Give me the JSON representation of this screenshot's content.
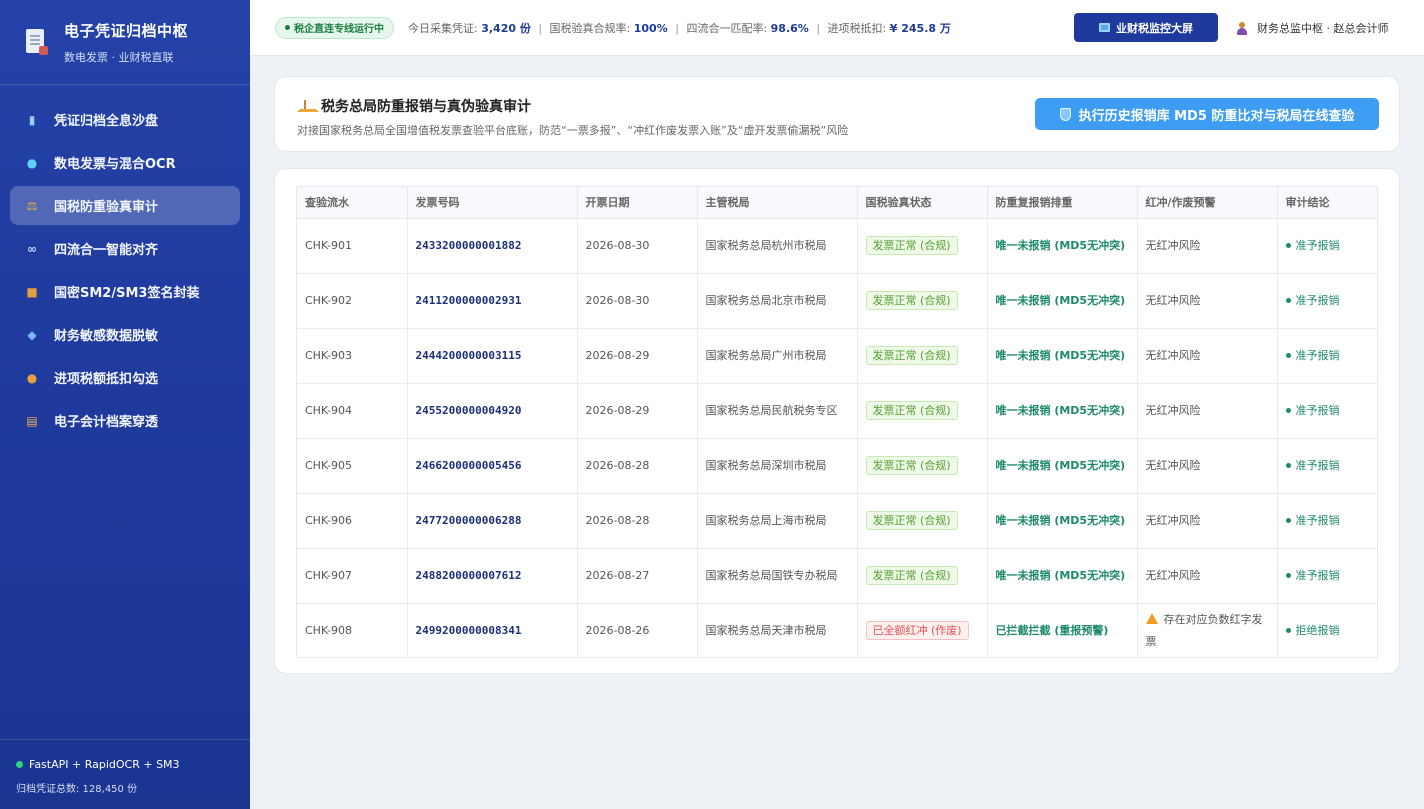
{
  "sidebar": {
    "brand_title": "电子凭证归档中枢",
    "brand_subtitle": "数电发票 · 业财税直联",
    "items": [
      {
        "label": "凭证归档全息沙盘",
        "icon": "bar-chart-icon"
      },
      {
        "label": "数电发票与混合OCR",
        "icon": "magnifier-icon"
      },
      {
        "label": "国税防重验真审计",
        "icon": "scale-icon"
      },
      {
        "label": "四流合一智能对齐",
        "icon": "link-icon"
      },
      {
        "label": "国密SM2/SM3签名封装",
        "icon": "lock-icon"
      },
      {
        "label": "财务敏感数据脱敏",
        "icon": "shield-icon"
      },
      {
        "label": "进项税额抵扣勾选",
        "icon": "money-bag-icon"
      },
      {
        "label": "电子会计档案穿透",
        "icon": "scroll-icon"
      }
    ],
    "active_index": 2,
    "footer_stack": "FastAPI + RapidOCR + SM3",
    "footer_total": "归档凭证总数: 128,450 份"
  },
  "topbar": {
    "status": "税企直连专线运行中",
    "metrics": {
      "collect_label": "今日采集凭证: ",
      "collect_value": "3,420 份",
      "verify_label": "国税验真合规率: ",
      "verify_value": "100%",
      "match_label": "四流合一匹配率: ",
      "match_value": "98.6%",
      "deduct_label": "进项税抵扣: ",
      "deduct_value": "¥ 245.8 万",
      "separator": "|"
    },
    "screen_button": "业财税监控大屏",
    "user": "财务总监中枢 · 赵总会计师"
  },
  "header": {
    "title": "税务总局防重报销与真伪验真审计",
    "description": "对接国家税务总局全国增值税发票查验平台底账，防范“一票多报”、“冲红作废发票入账”及“虚开发票偷漏税”风险",
    "action_button": "执行历史报销库 MD5 防重比对与税局在线查验"
  },
  "table": {
    "columns": [
      "查验流水",
      "发票号码",
      "开票日期",
      "主管税局",
      "国税验真状态",
      "防重复报销排重",
      "红冲/作废预警",
      "审计结论"
    ],
    "rows": [
      {
        "id": "CHK-901",
        "invoice": "2433200000001882",
        "date": "2026-08-30",
        "bureau": "国家税务总局杭州市税局",
        "status": "发票正常 (合规)",
        "status_type": "ok",
        "dup": "唯一未报销 (MD5无冲突)",
        "warn": "无红冲风险",
        "warn_alert": false,
        "conclusion": "准予报销"
      },
      {
        "id": "CHK-902",
        "invoice": "2411200000002931",
        "date": "2026-08-30",
        "bureau": "国家税务总局北京市税局",
        "status": "发票正常 (合规)",
        "status_type": "ok",
        "dup": "唯一未报销 (MD5无冲突)",
        "warn": "无红冲风险",
        "warn_alert": false,
        "conclusion": "准予报销"
      },
      {
        "id": "CHK-903",
        "invoice": "2444200000003115",
        "date": "2026-08-29",
        "bureau": "国家税务总局广州市税局",
        "status": "发票正常 (合规)",
        "status_type": "ok",
        "dup": "唯一未报销 (MD5无冲突)",
        "warn": "无红冲风险",
        "warn_alert": false,
        "conclusion": "准予报销"
      },
      {
        "id": "CHK-904",
        "invoice": "2455200000004920",
        "date": "2026-08-29",
        "bureau": "国家税务总局民航税务专区",
        "status": "发票正常 (合规)",
        "status_type": "ok",
        "dup": "唯一未报销 (MD5无冲突)",
        "warn": "无红冲风险",
        "warn_alert": false,
        "conclusion": "准予报销"
      },
      {
        "id": "CHK-905",
        "invoice": "2466200000005456",
        "date": "2026-08-28",
        "bureau": "国家税务总局深圳市税局",
        "status": "发票正常 (合规)",
        "status_type": "ok",
        "dup": "唯一未报销 (MD5无冲突)",
        "warn": "无红冲风险",
        "warn_alert": false,
        "conclusion": "准予报销"
      },
      {
        "id": "CHK-906",
        "invoice": "2477200000006288",
        "date": "2026-08-28",
        "bureau": "国家税务总局上海市税局",
        "status": "发票正常 (合规)",
        "status_type": "ok",
        "dup": "唯一未报销 (MD5无冲突)",
        "warn": "无红冲风险",
        "warn_alert": false,
        "conclusion": "准予报销"
      },
      {
        "id": "CHK-907",
        "invoice": "2488200000007612",
        "date": "2026-08-27",
        "bureau": "国家税务总局国铁专办税局",
        "status": "发票正常 (合规)",
        "status_type": "ok",
        "dup": "唯一未报销 (MD5无冲突)",
        "warn": "无红冲风险",
        "warn_alert": false,
        "conclusion": "准予报销"
      },
      {
        "id": "CHK-908",
        "invoice": "2499200000008341",
        "date": "2026-08-26",
        "bureau": "国家税务总局天津市税局",
        "status": "已全额红冲 (作废)",
        "status_type": "bad",
        "dup": "已拦截拦截 (重报预警)",
        "warn": "存在对应负数红字发票",
        "warn_alert": true,
        "conclusion": "拒绝报销"
      }
    ]
  },
  "colors": {
    "sidebar_bg": "#2442a8",
    "accent_blue": "#3d9df2",
    "primary_navy": "#1e3a9c",
    "ok_green": "#55a030",
    "danger_red": "#e05252",
    "teal": "#1e8a6a"
  }
}
